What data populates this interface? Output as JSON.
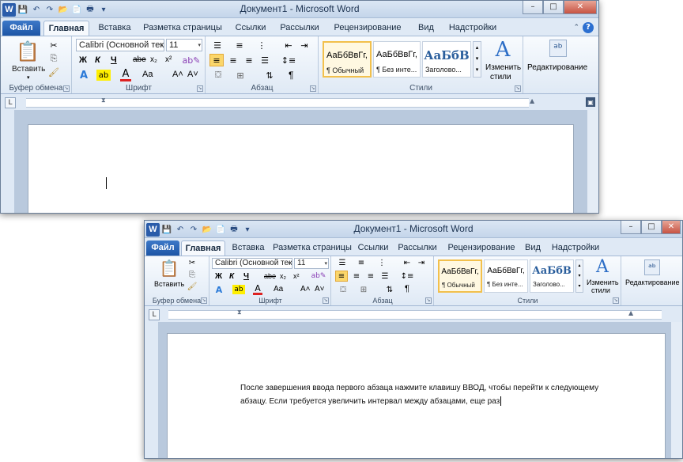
{
  "app": {
    "window_title": "Документ1 - Microsoft Word",
    "logo_letter": "W",
    "min_symbol": "–",
    "max_symbol": "□",
    "close_symbol": "✕",
    "help_symbol": "?"
  },
  "tabs": {
    "file": "Файл",
    "home": "Главная",
    "insert": "Вставка",
    "layout": "Разметка страницы",
    "references": "Ссылки",
    "mailings": "Рассылки",
    "review": "Рецензирование",
    "view": "Вид",
    "addins": "Надстройки"
  },
  "clipboard": {
    "paste_label": "Вставить",
    "group_label": "Буфер обмена"
  },
  "font": {
    "name_value": "Calibri (Основной тек",
    "size_value": "11",
    "bold": "Ж",
    "italic": "К",
    "underline": "Ч",
    "strike": "abe",
    "subscript": "x₂",
    "superscript": "x²",
    "grow": "A˄",
    "shrink": "A˅",
    "case": "Aa",
    "group_label": "Шрифт"
  },
  "paragraph": {
    "group_label": "Абзац",
    "pilcrow": "¶"
  },
  "styles": {
    "tiles": [
      {
        "sample": "АаБбВвГг,",
        "name": "¶ Обычный"
      },
      {
        "sample": "АаБбВвГг,",
        "name": "¶ Без инте..."
      },
      {
        "sample": "АаБбВ",
        "name": "Заголово..."
      }
    ],
    "change_label_1": "Изменить",
    "change_label_2": "стили",
    "group_label": "Стили"
  },
  "editing": {
    "label": "Редактирование"
  },
  "document2": {
    "line1": "После завершения ввода первого абзаца нажмите клавишу ВВОД, чтобы перейти к следующему",
    "line2": "абзацу. Если требуется увеличить интервал между абзацами, еще раз"
  },
  "colors": {
    "title_text": "#1e3452",
    "file_tab": "#1e55a6",
    "accent": "#2c6fd0",
    "selected_style": "#f2c04c"
  }
}
